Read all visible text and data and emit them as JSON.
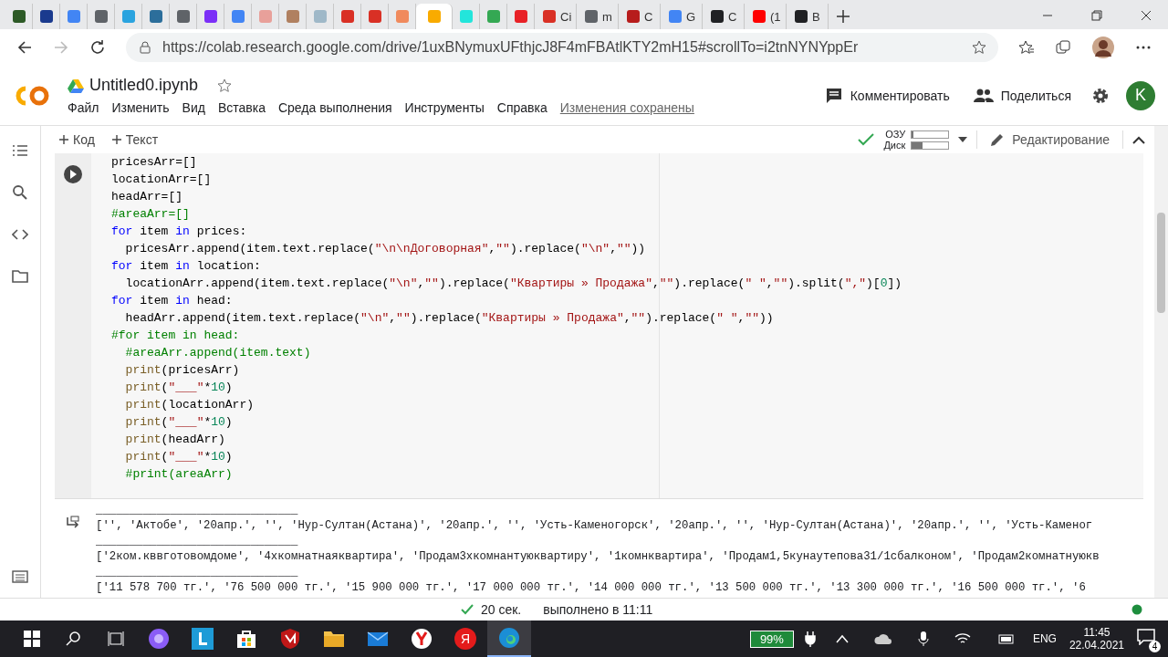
{
  "browser": {
    "tabs": [
      {
        "color": "#2d5a27",
        "selected": false
      },
      {
        "color": "#1a3a8e",
        "selected": false
      },
      {
        "color": "#4285f4",
        "selected": false
      },
      {
        "color": "#5f6368",
        "selected": false
      },
      {
        "color": "#2aa3df",
        "selected": false
      },
      {
        "color": "#2c6e9b",
        "selected": false
      },
      {
        "color": "#5f6368",
        "selected": false
      },
      {
        "color": "#7b2ff7",
        "selected": false
      },
      {
        "color": "#4285f4",
        "selected": false
      },
      {
        "color": "#e8a09a",
        "selected": false
      },
      {
        "color": "#b08060",
        "selected": false
      },
      {
        "color": "#9fb8c8",
        "selected": false
      },
      {
        "color": "#d93025",
        "selected": false
      },
      {
        "color": "#d93025",
        "selected": false
      },
      {
        "color": "#f08a5d",
        "selected": false
      },
      {
        "color": "#f9ab00",
        "selected": true
      },
      {
        "color": "#23e5db",
        "selected": false
      },
      {
        "color": "#34a853",
        "selected": false
      },
      {
        "color": "#e82127",
        "selected": false
      },
      {
        "color": "#d93025",
        "label": "Ci",
        "selected": false
      },
      {
        "color": "#5f6368",
        "label": "m",
        "selected": false
      },
      {
        "color": "#b71c1c",
        "label": "C",
        "selected": false
      },
      {
        "color": "#4285f4",
        "label": "G",
        "selected": false
      },
      {
        "color": "#202124",
        "label": "C",
        "selected": false
      },
      {
        "color": "#ff0000",
        "label": "(1",
        "selected": false
      },
      {
        "color": "#202124",
        "label": "B",
        "selected": false
      }
    ],
    "url": "https://colab.research.google.com/drive/1uxBNymuxUFthjcJ8F4mFBAtlKTY2mH15#scrollTo=i2tnNYNYppEr"
  },
  "notebook": {
    "title": "Untitled0.ipynb",
    "menu": [
      "Файл",
      "Изменить",
      "Вид",
      "Вставка",
      "Среда выполнения",
      "Инструменты",
      "Справка"
    ],
    "save_status": "Изменения сохранены",
    "comment": "Комментировать",
    "share": "Поделиться",
    "avatar": "K"
  },
  "toolbar": {
    "add_code": "Код",
    "add_text": "Текст",
    "ram": {
      "label": "ОЗУ",
      "level": 0.04
    },
    "disk": {
      "label": "Диск",
      "level": 0.3
    },
    "mode": "Редактирование"
  },
  "code_lines": [
    {
      "tokens": [
        {
          "kind": "plain",
          "t": "pricesArr=[]"
        }
      ]
    },
    {
      "tokens": [
        {
          "kind": "plain",
          "t": "locationArr=[]"
        }
      ]
    },
    {
      "tokens": [
        {
          "kind": "plain",
          "t": "headArr=[]"
        }
      ]
    },
    {
      "tokens": [
        {
          "kind": "comment",
          "t": "#areaArr=[]"
        }
      ]
    },
    {
      "tokens": [
        {
          "kind": "keyword",
          "t": "for"
        },
        {
          "kind": "plain",
          "t": " item "
        },
        {
          "kind": "keyword",
          "t": "in"
        },
        {
          "kind": "plain",
          "t": " prices:"
        }
      ]
    },
    {
      "tokens": [
        {
          "kind": "plain",
          "t": "  pricesArr.append(item.text.replace("
        },
        {
          "kind": "string",
          "t": "\"\\n\\nДоговорная\""
        },
        {
          "kind": "plain",
          "t": ","
        },
        {
          "kind": "string",
          "t": "\"\""
        },
        {
          "kind": "plain",
          "t": ").replace("
        },
        {
          "kind": "string",
          "t": "\"\\n\""
        },
        {
          "kind": "plain",
          "t": ","
        },
        {
          "kind": "string",
          "t": "\"\""
        },
        {
          "kind": "plain",
          "t": "))"
        }
      ]
    },
    {
      "tokens": [
        {
          "kind": "keyword",
          "t": "for"
        },
        {
          "kind": "plain",
          "t": " item "
        },
        {
          "kind": "keyword",
          "t": "in"
        },
        {
          "kind": "plain",
          "t": " location:"
        }
      ]
    },
    {
      "tokens": [
        {
          "kind": "plain",
          "t": "  locationArr.append(item.text.replace("
        },
        {
          "kind": "string",
          "t": "\"\\n\""
        },
        {
          "kind": "plain",
          "t": ","
        },
        {
          "kind": "string",
          "t": "\"\""
        },
        {
          "kind": "plain",
          "t": ").replace("
        },
        {
          "kind": "string",
          "t": "\"Квартиры » Продажа\""
        },
        {
          "kind": "plain",
          "t": ","
        },
        {
          "kind": "string",
          "t": "\"\""
        },
        {
          "kind": "plain",
          "t": ").replace("
        },
        {
          "kind": "string",
          "t": "\" \""
        },
        {
          "kind": "plain",
          "t": ","
        },
        {
          "kind": "string",
          "t": "\"\""
        },
        {
          "kind": "plain",
          "t": ").split("
        },
        {
          "kind": "string",
          "t": "\",\""
        },
        {
          "kind": "plain",
          "t": ")["
        },
        {
          "kind": "number",
          "t": "0"
        },
        {
          "kind": "plain",
          "t": "])"
        }
      ]
    },
    {
      "tokens": [
        {
          "kind": "keyword",
          "t": "for"
        },
        {
          "kind": "plain",
          "t": " item "
        },
        {
          "kind": "keyword",
          "t": "in"
        },
        {
          "kind": "plain",
          "t": " head:"
        }
      ]
    },
    {
      "tokens": [
        {
          "kind": "plain",
          "t": "  headArr.append(item.text.replace("
        },
        {
          "kind": "string",
          "t": "\"\\n\""
        },
        {
          "kind": "plain",
          "t": ","
        },
        {
          "kind": "string",
          "t": "\"\""
        },
        {
          "kind": "plain",
          "t": ").replace("
        },
        {
          "kind": "string",
          "t": "\"Квартиры » Продажа\""
        },
        {
          "kind": "plain",
          "t": ","
        },
        {
          "kind": "string",
          "t": "\"\""
        },
        {
          "kind": "plain",
          "t": ").replace("
        },
        {
          "kind": "string",
          "t": "\" \""
        },
        {
          "kind": "plain",
          "t": ","
        },
        {
          "kind": "string",
          "t": "\"\""
        },
        {
          "kind": "plain",
          "t": "))"
        }
      ]
    },
    {
      "tokens": [
        {
          "kind": "comment",
          "t": "#for item in head:"
        }
      ]
    },
    {
      "tokens": [
        {
          "kind": "comment",
          "t": "  #areaArr.append(item.text)"
        }
      ]
    },
    {
      "tokens": [
        {
          "kind": "function",
          "t": "  print"
        },
        {
          "kind": "plain",
          "t": "(pricesArr)"
        }
      ]
    },
    {
      "tokens": [
        {
          "kind": "function",
          "t": "  print"
        },
        {
          "kind": "plain",
          "t": "("
        },
        {
          "kind": "string",
          "t": "\"___\""
        },
        {
          "kind": "plain",
          "t": "*"
        },
        {
          "kind": "number",
          "t": "10"
        },
        {
          "kind": "plain",
          "t": ")"
        }
      ]
    },
    {
      "tokens": [
        {
          "kind": "function",
          "t": "  print"
        },
        {
          "kind": "plain",
          "t": "(locationArr)"
        }
      ]
    },
    {
      "tokens": [
        {
          "kind": "function",
          "t": "  print"
        },
        {
          "kind": "plain",
          "t": "("
        },
        {
          "kind": "string",
          "t": "\"___\""
        },
        {
          "kind": "plain",
          "t": "*"
        },
        {
          "kind": "number",
          "t": "10"
        },
        {
          "kind": "plain",
          "t": ")"
        }
      ]
    },
    {
      "tokens": [
        {
          "kind": "function",
          "t": "  print"
        },
        {
          "kind": "plain",
          "t": "(headArr)"
        }
      ]
    },
    {
      "tokens": [
        {
          "kind": "function",
          "t": "  print"
        },
        {
          "kind": "plain",
          "t": "("
        },
        {
          "kind": "string",
          "t": "\"___\""
        },
        {
          "kind": "plain",
          "t": "*"
        },
        {
          "kind": "number",
          "t": "10"
        },
        {
          "kind": "plain",
          "t": ")"
        }
      ]
    },
    {
      "tokens": [
        {
          "kind": "comment",
          "t": "  #print(areaArr)"
        }
      ]
    }
  ],
  "output_lines": [
    "______________________________",
    "['', 'Актобе', '20апр.', '', 'Нур-Султан(Астана)', '20апр.', '', 'Усть-Каменогорск', '20апр.', '', 'Нур-Султан(Астана)', '20апр.', '', 'Усть-Каменог",
    "______________________________",
    "['2ком.кввготовомдоме', '4хкомнатнаяквартира', 'Продам3хкомнантуюквартиру', '1комнквартира', 'Продам1,5кунаутепова31/1сбалконом', 'Продам2комнатнуюкв",
    "______________________________",
    "['11 578 700 тг.', '76 500 000 тг.', '15 900 000 тг.', '17 000 000 тг.', '14 000 000 тг.', '13 500 000 тг.', '13 300 000 тг.', '16 500 000 тг.', '6"
  ],
  "status": {
    "duration": "20 сек.",
    "done": "выполнено в 11:11"
  },
  "taskbar": {
    "apps": [
      {
        "kind": "assistant",
        "selected": false
      },
      {
        "kind": "launcher",
        "selected": false
      },
      {
        "kind": "store",
        "selected": false
      },
      {
        "kind": "shield",
        "selected": false
      },
      {
        "kind": "folder",
        "selected": false
      },
      {
        "kind": "mail",
        "selected": false
      },
      {
        "kind": "ybrowser",
        "selected": false
      },
      {
        "kind": "yandex",
        "label": "Я",
        "selected": false
      },
      {
        "kind": "edge",
        "selected": true
      }
    ],
    "battery": "99%",
    "language": "ENG",
    "time": "11:45",
    "date": "22.04.2021",
    "notifications": "4"
  }
}
